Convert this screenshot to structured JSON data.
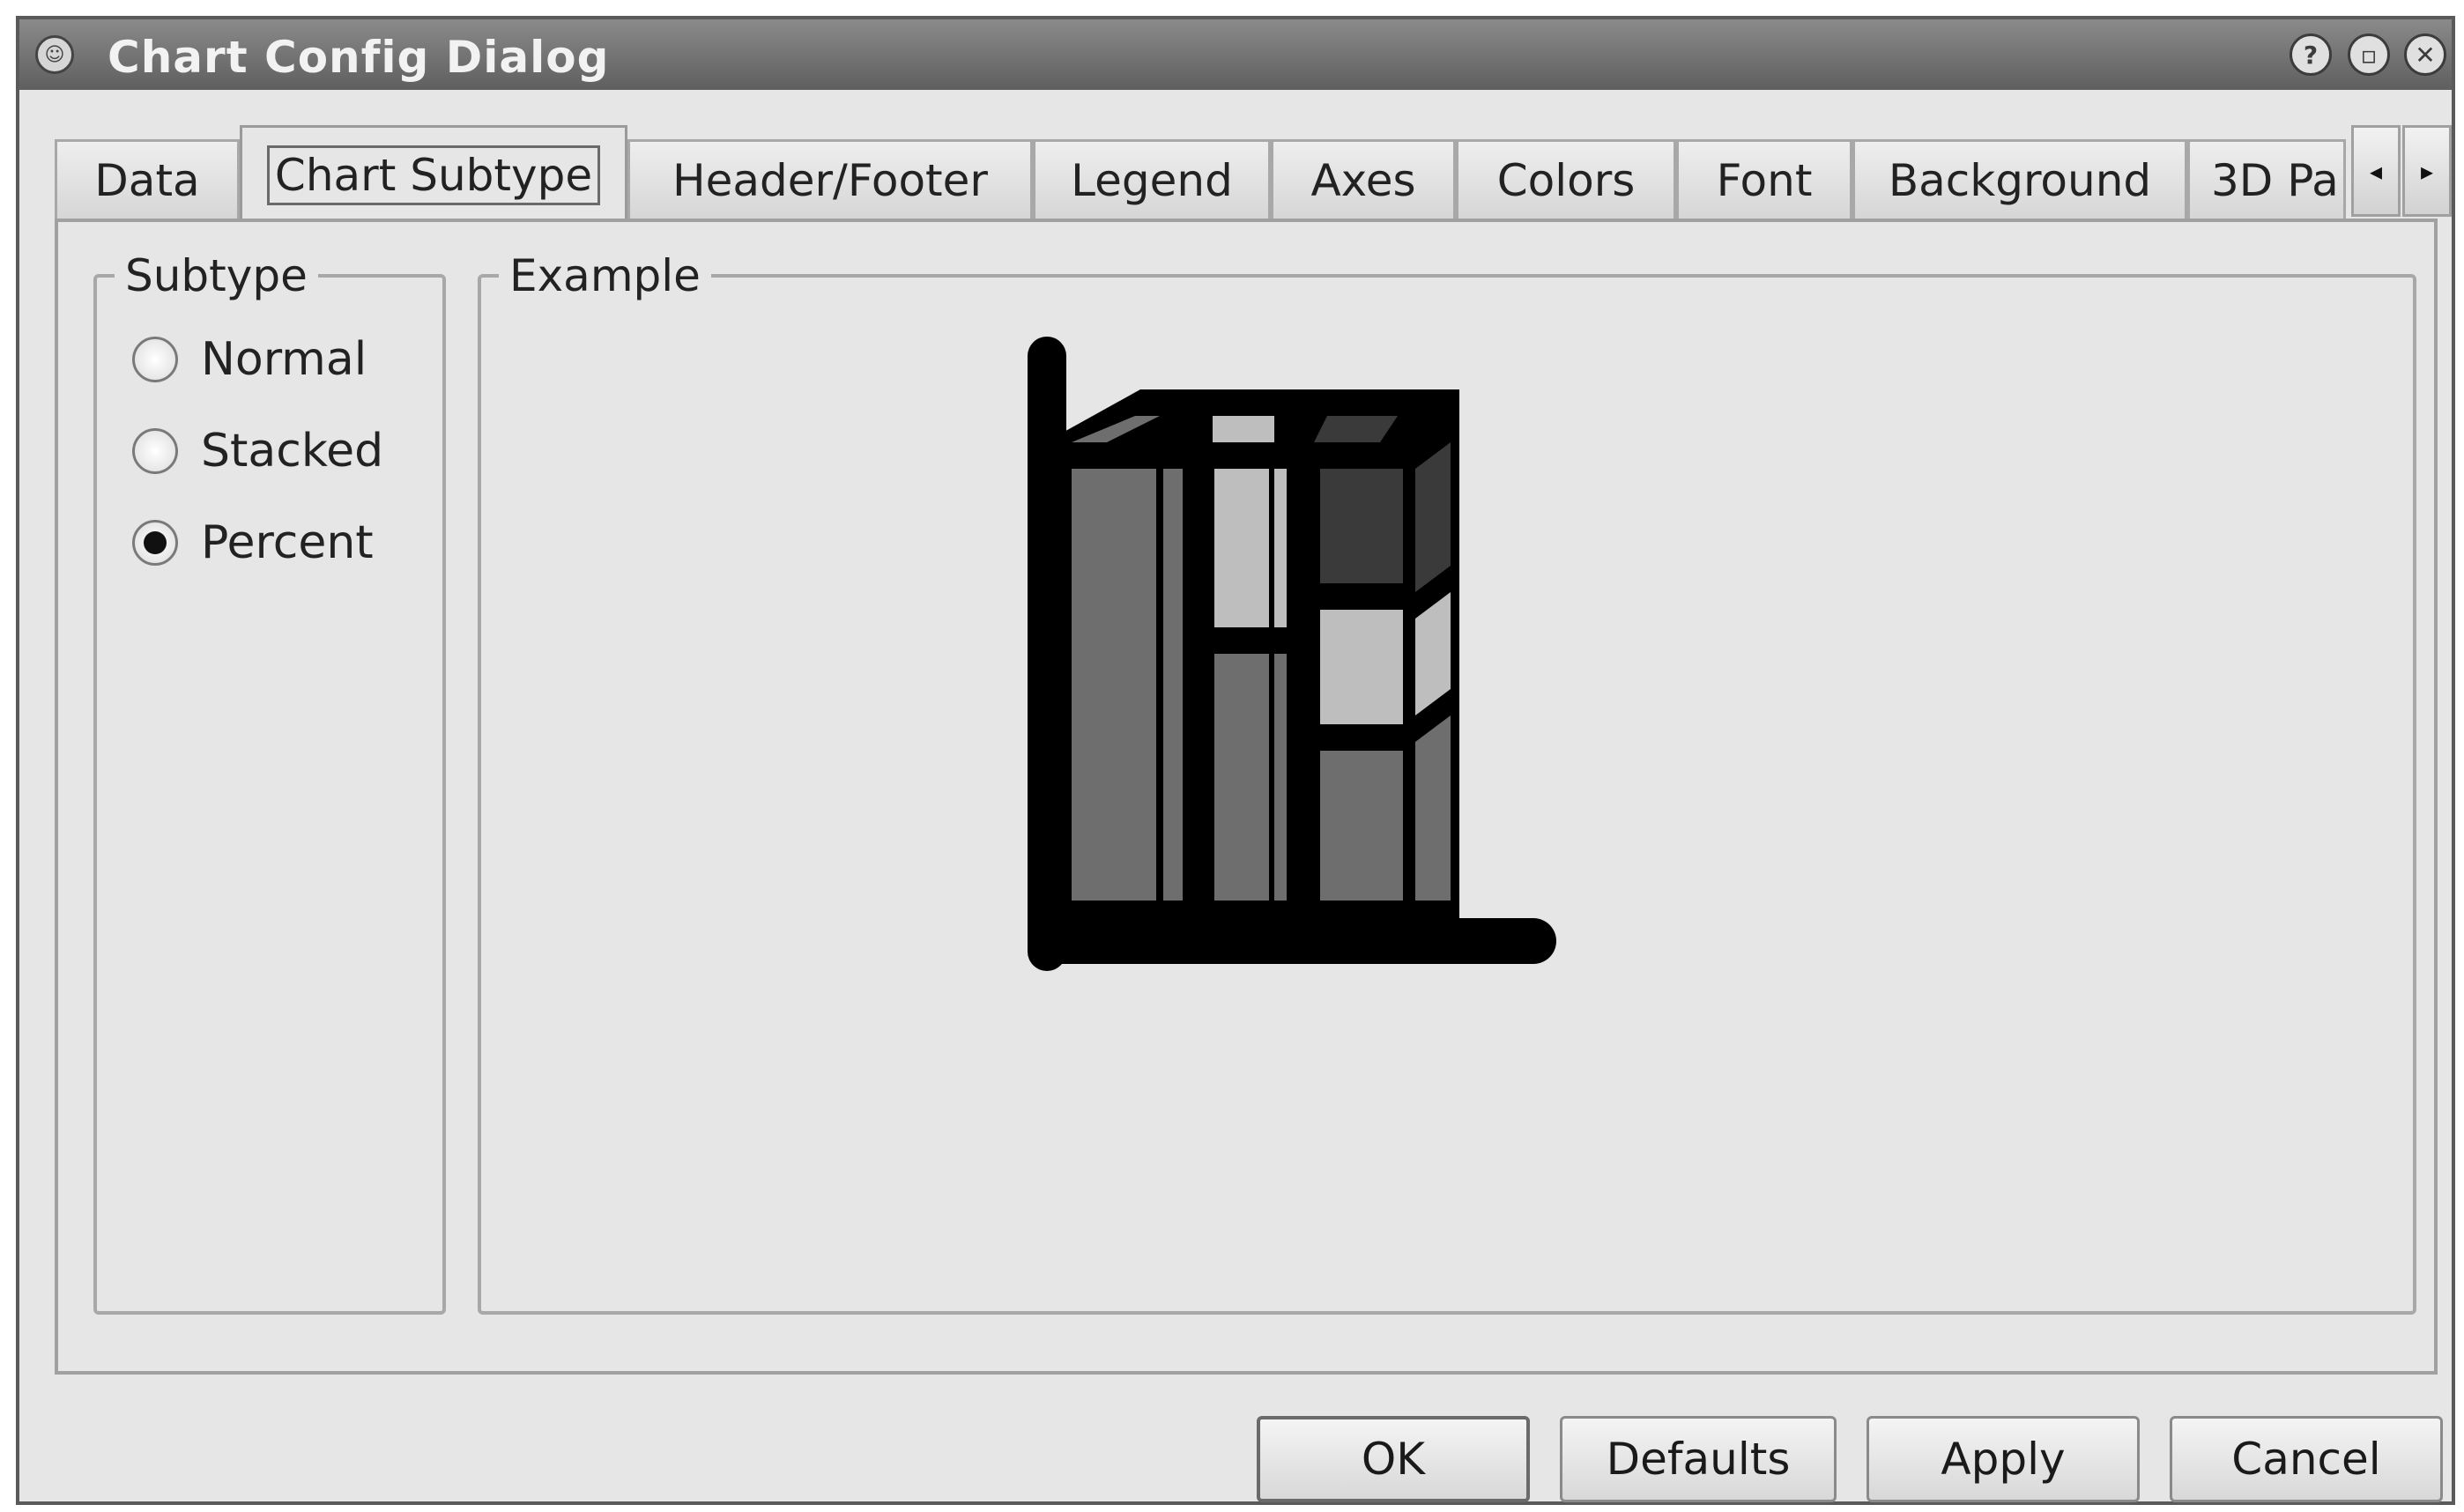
{
  "window": {
    "title": "Chart Config Dialog",
    "help_glyph": "?",
    "minimize_glyph": "▫",
    "close_glyph": "✕"
  },
  "tabs": [
    {
      "label": "Data"
    },
    {
      "label": "Chart Subtype",
      "active": true
    },
    {
      "label": "Header/Footer"
    },
    {
      "label": "Legend"
    },
    {
      "label": "Axes"
    },
    {
      "label": "Colors"
    },
    {
      "label": "Font"
    },
    {
      "label": "Background"
    },
    {
      "label": "3D Pa"
    }
  ],
  "tab_scroll": {
    "left_glyph": "◂",
    "right_glyph": "▸"
  },
  "subtype": {
    "title": "Subtype",
    "options": [
      {
        "label": "Normal",
        "checked": false
      },
      {
        "label": "Stacked",
        "checked": false
      },
      {
        "label": "Percent",
        "checked": true
      }
    ]
  },
  "example": {
    "title": "Example",
    "icon": "percent-bar-chart-icon"
  },
  "buttons": {
    "ok": "OK",
    "defaults": "Defaults",
    "apply": "Apply",
    "cancel": "Cancel"
  },
  "colors": {
    "dark": "#3a3a3a",
    "mid": "#6e6e6e",
    "light": "#bebebe",
    "outline": "#000000"
  }
}
